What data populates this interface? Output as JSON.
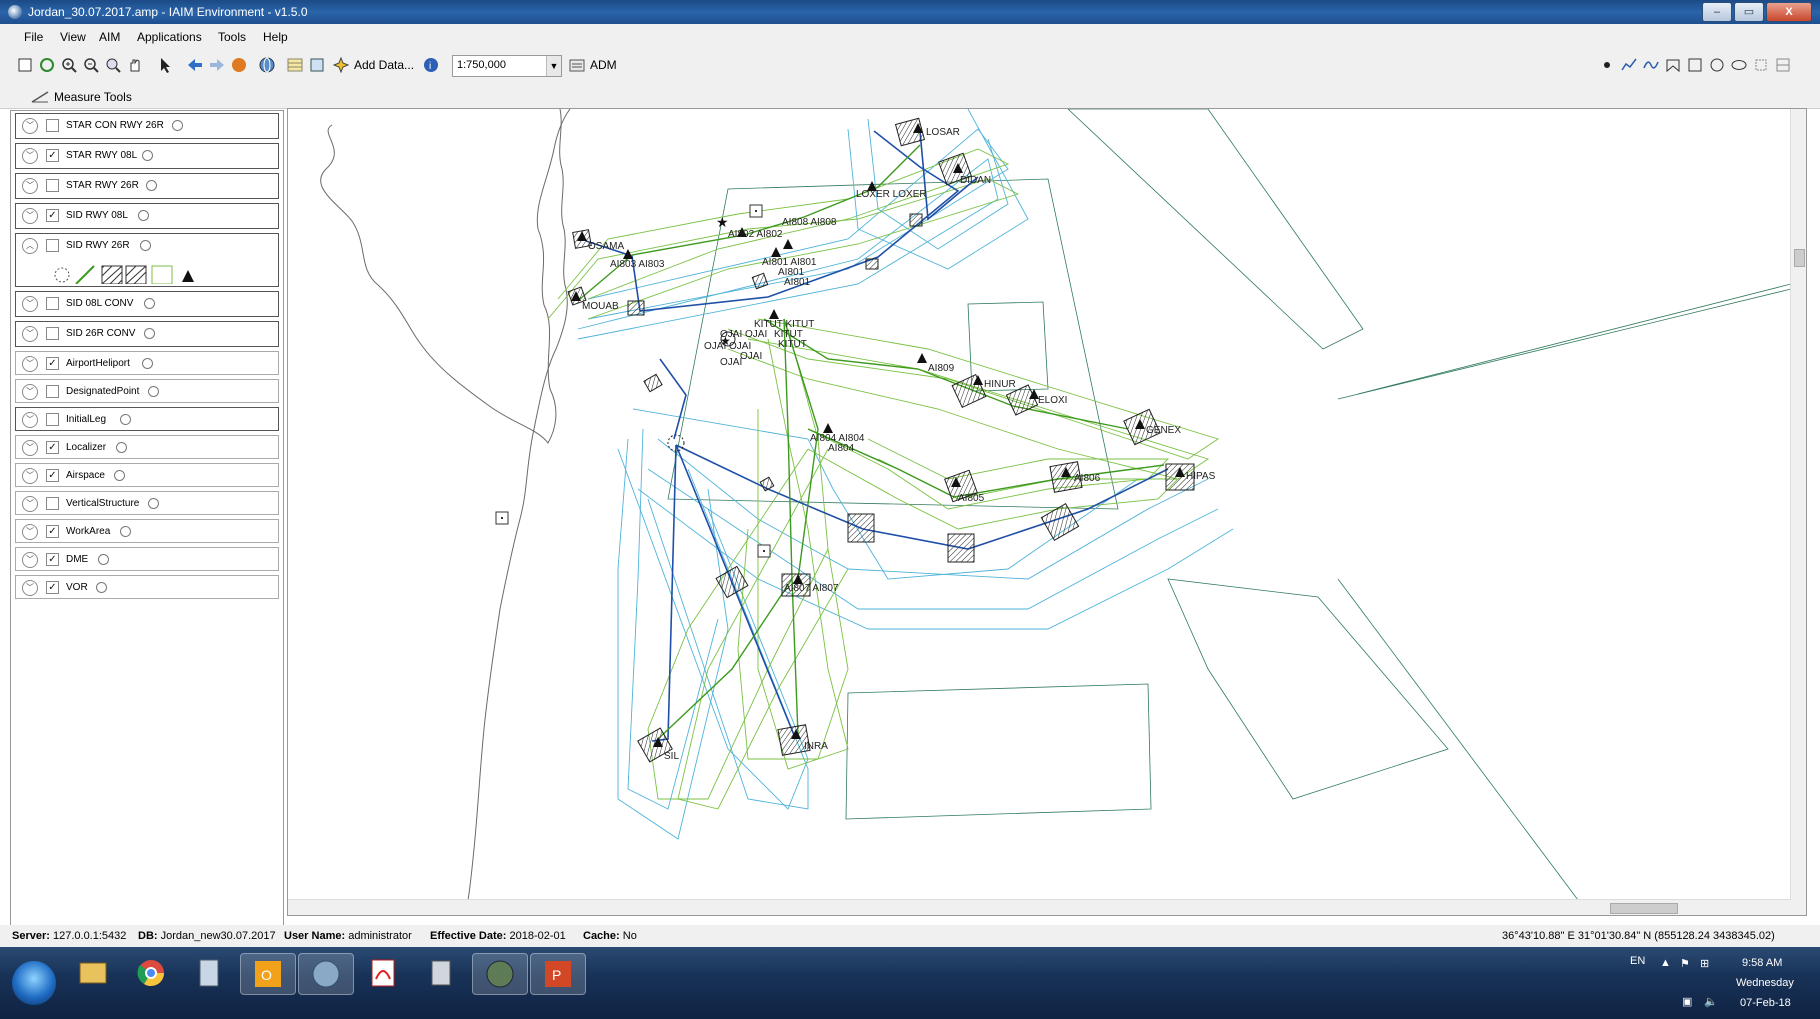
{
  "window": {
    "title": "Jordan_30.07.2017.amp - IAIM Environment - v1.5.0",
    "buttons": [
      "–",
      "▭",
      "X"
    ]
  },
  "menu": [
    "File",
    "View",
    "AIM",
    "Applications",
    "Tools",
    "Help"
  ],
  "toolbar": {
    "add_data_label": "Add Data...",
    "scale_value": "1:750,000",
    "adm_label": "ADM"
  },
  "measure_tools_label": "Measure Tools",
  "layers": [
    {
      "name": "STAR CON RWY 26R",
      "checked": false
    },
    {
      "name": "STAR RWY 08L",
      "checked": true
    },
    {
      "name": "STAR RWY 26R",
      "checked": false
    },
    {
      "name": "SID RWY 08L",
      "checked": true
    },
    {
      "name": "SID RWY 26R",
      "checked": false
    },
    {
      "name": "SID 08L CONV",
      "checked": false
    },
    {
      "name": "SID 26R CONV",
      "checked": false
    },
    {
      "name": "AirportHeliport",
      "checked": true
    },
    {
      "name": "DesignatedPoint",
      "checked": false
    },
    {
      "name": "InitialLeg",
      "checked": false
    },
    {
      "name": "Localizer",
      "checked": true
    },
    {
      "name": "Airspace",
      "checked": true
    },
    {
      "name": "VerticalStructure",
      "checked": false
    },
    {
      "name": "WorkArea",
      "checked": true
    },
    {
      "name": "DME",
      "checked": true
    },
    {
      "name": "VOR",
      "checked": true
    }
  ],
  "map_labels": {
    "losar": "LOSAR",
    "didan": "DIDAN",
    "loxer": "LOXER LOXER",
    "ai808": "AI808 AI808",
    "ai802": "AI802 AI802",
    "osama": "OSAMA",
    "ai803": "AI803 AI803",
    "ai801a": "AI801 AI801",
    "ai801b": "AI801",
    "ai801c": "AI801",
    "mouab": "MOUAB",
    "kitut": "KITUT KITUT",
    "kitut2": "KITUT",
    "kitut3": "KITUT",
    "ojai1": "OJAI OJAI",
    "ojai2": "OJAI OJAI",
    "ojai3": "OJAI",
    "ojai4": "OJAI",
    "ai809": "AI809",
    "hinur": "HINUR",
    "eloxi": "ELOXI",
    "genex": "GENEX",
    "ai804": "AI804 AI804",
    "ai804b": "AI804",
    "ai806": "AI806",
    "hipas": "HIPAS",
    "ai805": "AI805",
    "ai807": "AI807 AI807",
    "inra": "INRA",
    "sil": "SIL"
  },
  "status": {
    "server_label": "Server:",
    "server": "127.0.0.1:5432",
    "db_label": "DB:",
    "db": "Jordan_new30.07.2017",
    "user_label": "User Name:",
    "user": "administrator",
    "eff_label": "Effective Date:",
    "eff": "2018-02-01",
    "cache_label": "Cache:",
    "cache": "No",
    "coords": "36°43'10.88\" E  31°01'30.84\" N  (855128.24  3438345.02)"
  },
  "tray": {
    "lang": "EN",
    "time": "9:58 AM",
    "day": "Wednesday",
    "date": "07-Feb-18"
  },
  "colors": {
    "route_blue": "#1f4fa8",
    "route_green": "#3d9a1e",
    "buffer_cyan": "#4fb3d9",
    "buffer_green": "#7ac143",
    "workarea": "#2f7a5a"
  }
}
